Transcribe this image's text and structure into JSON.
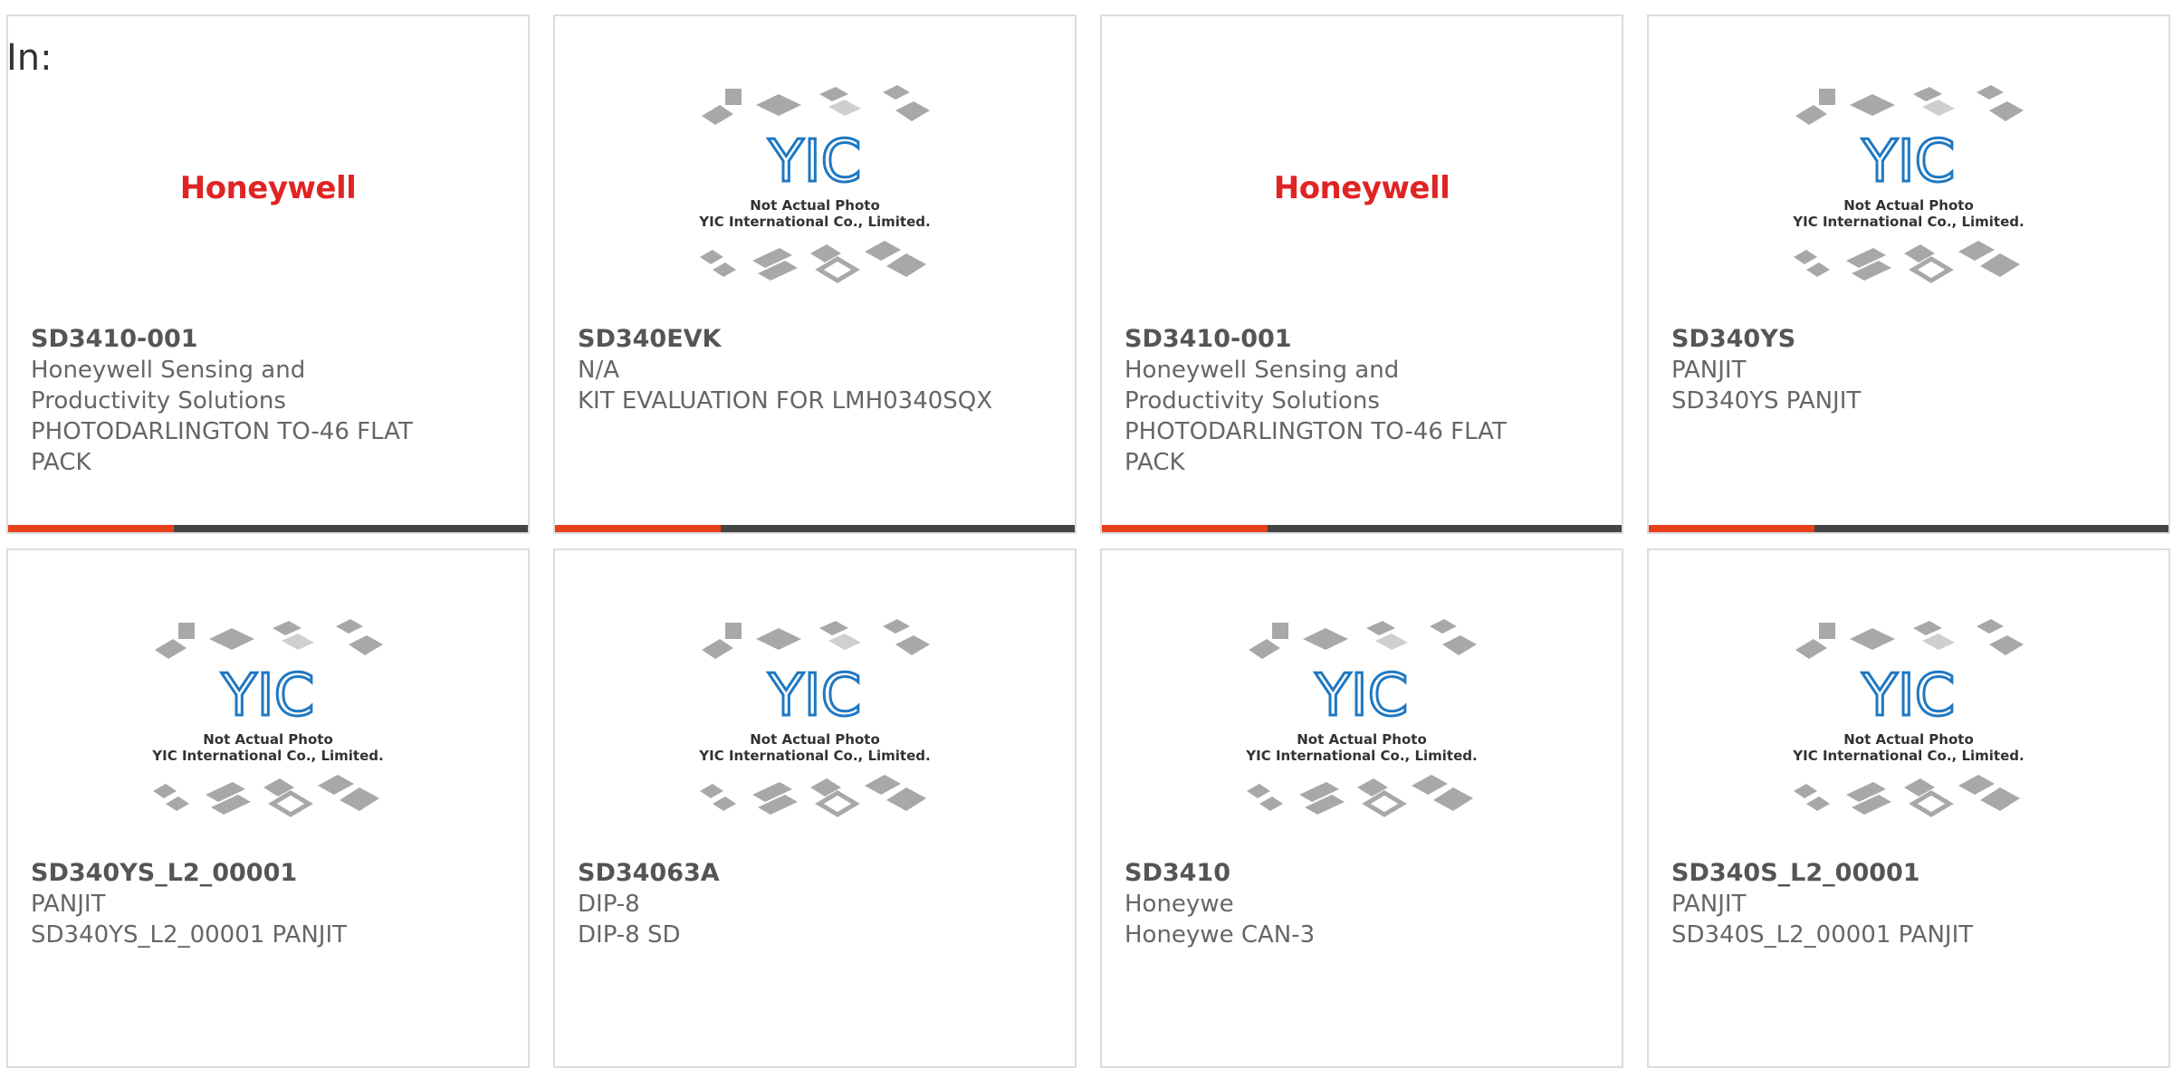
{
  "prefix_label": "In:",
  "colors": {
    "accent": "#e8401a",
    "bar": "#444444",
    "honeywell_red": "#e02424",
    "yic_blue": "#1f78c1"
  },
  "products": [
    {
      "part": "SD3410-001",
      "manufacturer": "Honeywell Sensing and Productivity Solutions",
      "description": "PHOTODARLINGTON TO-46 FLAT PACK",
      "image": "honeywell-logo",
      "logo_text": "Honeywell"
    },
    {
      "part": "SD340EVK",
      "manufacturer": "N/A",
      "description": "KIT EVALUATION FOR LMH0340SQX",
      "image": "yic-placeholder",
      "caption1": "Not Actual Photo",
      "caption2": "YIC International Co., Limited."
    },
    {
      "part": "SD3410-001",
      "manufacturer": "Honeywell Sensing and Productivity Solutions",
      "description": "PHOTODARLINGTON TO-46 FLAT PACK",
      "image": "honeywell-logo",
      "logo_text": "Honeywell"
    },
    {
      "part": "SD340YS",
      "manufacturer": "PANJIT",
      "description": "SD340YS PANJIT",
      "image": "yic-placeholder",
      "caption1": "Not Actual Photo",
      "caption2": "YIC International Co., Limited."
    },
    {
      "part": "SD340YS_L2_00001",
      "manufacturer": "PANJIT",
      "description": "SD340YS_L2_00001 PANJIT",
      "image": "yic-placeholder",
      "caption1": "Not Actual Photo",
      "caption2": "YIC International Co., Limited."
    },
    {
      "part": "SD34063A",
      "manufacturer": "DIP-8",
      "description": "DIP-8 SD",
      "image": "yic-placeholder",
      "caption1": "Not Actual Photo",
      "caption2": "YIC International Co., Limited."
    },
    {
      "part": "SD3410",
      "manufacturer": "Honeywe",
      "description": "Honeywe CAN-3",
      "image": "yic-placeholder",
      "caption1": "Not Actual Photo",
      "caption2": "YIC International Co., Limited."
    },
    {
      "part": "SD340S_L2_00001",
      "manufacturer": "PANJIT",
      "description": "SD340S_L2_00001 PANJIT",
      "image": "yic-placeholder",
      "caption1": "Not Actual Photo",
      "caption2": "YIC International Co., Limited."
    }
  ]
}
